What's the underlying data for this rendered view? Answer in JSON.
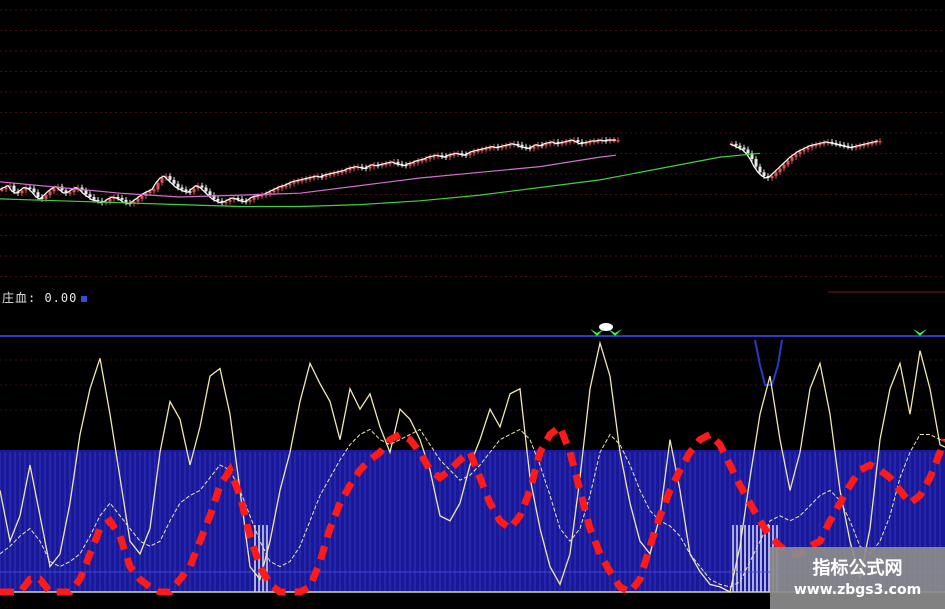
{
  "indicator": {
    "label": "庄血: 0.00"
  },
  "watermark": {
    "title": "指标公式网",
    "url": "www.zbgs3.com"
  },
  "colors": {
    "background": "#000000",
    "gridline": "#7a1c1c",
    "up_candle": "#e05050",
    "down_candle": "#e8e8e8",
    "ma_short": "#ffffff",
    "ma_mid": "#d070d0",
    "ma_long": "#40d040",
    "osc_line": "#f0e8b0",
    "blue_zone": "#1e1ebe",
    "red_line": "#ff1a1a",
    "signal": "#30ff30",
    "divider": "#2a3ac8"
  },
  "chart_data": [
    {
      "type": "candlestick",
      "panel": "price",
      "grid": true,
      "ylim": [
        0,
        100
      ],
      "x": [
        0,
        4,
        8,
        12,
        16,
        20,
        24,
        28,
        32,
        36,
        40,
        44,
        48,
        52,
        56,
        60,
        64,
        68,
        72,
        76,
        80,
        84,
        88,
        92,
        96,
        100,
        104,
        108,
        112,
        116,
        120,
        124,
        128,
        132,
        136,
        140,
        144,
        148,
        152,
        156,
        160,
        164,
        168,
        172,
        176,
        180,
        184,
        188,
        192,
        196,
        200,
        204,
        208,
        212,
        216,
        220,
        224,
        228,
        232,
        236,
        240,
        244,
        248,
        252,
        256,
        260,
        264,
        268,
        272,
        276,
        280,
        284,
        288,
        292,
        296,
        300,
        304,
        308,
        312,
        316,
        320,
        324,
        328,
        332,
        336,
        340,
        344,
        348,
        352,
        356,
        360,
        364,
        368,
        372,
        376,
        380,
        384,
        388,
        392,
        396,
        400,
        404,
        408,
        412,
        416,
        420,
        424,
        428,
        432,
        436,
        440,
        444,
        448,
        452,
        456,
        460,
        464,
        468,
        472,
        476,
        480,
        484,
        488,
        492,
        496,
        500,
        504,
        508,
        512,
        516,
        520,
        524,
        528,
        532,
        536,
        540,
        544,
        548,
        552,
        556,
        560,
        564,
        568,
        572,
        576,
        580,
        584,
        588,
        592,
        596,
        600,
        604,
        608,
        612,
        616
      ],
      "close": [
        48,
        50,
        52,
        46,
        44,
        47,
        50,
        49,
        45,
        40,
        38,
        42,
        46,
        49,
        51,
        47,
        44,
        45,
        48,
        50,
        47,
        43,
        40,
        37,
        36,
        34,
        35,
        38,
        40,
        39,
        37,
        34,
        33,
        35,
        38,
        41,
        44,
        46,
        48,
        55,
        60,
        62,
        58,
        54,
        50,
        48,
        46,
        45,
        49,
        52,
        50,
        46,
        42,
        38,
        36,
        34,
        35,
        37,
        39,
        38,
        36,
        35,
        37,
        40,
        41,
        42,
        43,
        45,
        47,
        49,
        51,
        52,
        54,
        56,
        57,
        58,
        59,
        60,
        61,
        62,
        61,
        63,
        64,
        65,
        66,
        67,
        68,
        70,
        71,
        72,
        71,
        70,
        72,
        74,
        73,
        74,
        75,
        76,
        77,
        75,
        74,
        73,
        75,
        76,
        78,
        79,
        80,
        82,
        83,
        84,
        83,
        82,
        84,
        85,
        86,
        85,
        84,
        86,
        88,
        89,
        90,
        91,
        92,
        93,
        92,
        93,
        94,
        95,
        96,
        95,
        93,
        92,
        91,
        93,
        95,
        94,
        96,
        97,
        98,
        96,
        97,
        98,
        99,
        100,
        98,
        96,
        97,
        98,
        99,
        99,
        100,
        99,
        100,
        100,
        100
      ],
      "ma_short_note": "follows close",
      "segment2": {
        "x": [
          730,
          734,
          738,
          742,
          746,
          750,
          754,
          758,
          762,
          766,
          770,
          774,
          778,
          782,
          786,
          790,
          794,
          798,
          802,
          806,
          810,
          814,
          818,
          822,
          826,
          830,
          834,
          838,
          842,
          846,
          850,
          854,
          858,
          862,
          866,
          870,
          874,
          878
        ],
        "close": [
          96,
          94,
          92,
          90,
          86,
          80,
          72,
          66,
          62,
          60,
          62,
          66,
          70,
          74,
          78,
          82,
          85,
          88,
          90,
          92,
          94,
          95,
          96,
          97,
          98,
          97,
          96,
          95,
          94,
          93,
          92,
          93,
          94,
          95,
          96,
          97,
          98,
          99
        ]
      },
      "series": [
        {
          "name": "",
          "role": "ma_mid",
          "x": [
            0,
            60,
            120,
            180,
            240,
            300,
            360,
            420,
            480,
            540,
            600,
            616
          ],
          "y": [
            56,
            50,
            44,
            40,
            42,
            44,
            52,
            60,
            66,
            72,
            82,
            84
          ]
        },
        {
          "name": "",
          "role": "ma_long",
          "x": [
            0,
            60,
            120,
            180,
            240,
            300,
            360,
            420,
            480,
            540,
            600,
            660,
            720,
            760
          ],
          "y": [
            38,
            36,
            34,
            32,
            30,
            30,
            32,
            36,
            42,
            50,
            58,
            70,
            82,
            86
          ]
        }
      ]
    },
    {
      "type": "line",
      "panel": "oscillator",
      "grid": false,
      "ylim": [
        0,
        100
      ],
      "x": [
        0,
        10,
        20,
        30,
        40,
        50,
        60,
        70,
        80,
        90,
        100,
        110,
        120,
        130,
        140,
        150,
        160,
        170,
        180,
        190,
        200,
        210,
        220,
        230,
        240,
        250,
        260,
        270,
        280,
        290,
        300,
        310,
        320,
        330,
        340,
        350,
        360,
        370,
        380,
        390,
        400,
        410,
        420,
        430,
        440,
        450,
        460,
        470,
        480,
        490,
        500,
        510,
        520,
        530,
        540,
        550,
        560,
        570,
        580,
        590,
        600,
        610,
        620,
        630,
        640,
        650,
        660,
        670,
        680,
        690,
        700,
        710,
        720,
        730,
        740,
        750,
        760,
        770,
        780,
        790,
        800,
        810,
        820,
        830,
        840,
        850,
        860,
        870,
        880,
        890,
        900,
        910,
        920,
        930,
        940,
        945
      ],
      "series": [
        {
          "name": "",
          "role": "osc_line",
          "y": [
            40,
            20,
            30,
            50,
            30,
            10,
            15,
            35,
            62,
            80,
            92,
            70,
            45,
            20,
            15,
            25,
            55,
            75,
            68,
            50,
            65,
            85,
            88,
            70,
            40,
            10,
            5,
            20,
            40,
            55,
            75,
            90,
            82,
            75,
            60,
            80,
            72,
            78,
            65,
            55,
            72,
            68,
            60,
            48,
            30,
            28,
            35,
            50,
            60,
            72,
            65,
            78,
            80,
            45,
            25,
            10,
            3,
            15,
            45,
            80,
            98,
            85,
            55,
            35,
            20,
            15,
            30,
            60,
            40,
            15,
            8,
            3,
            2,
            0,
            18,
            45,
            70,
            85,
            60,
            40,
            55,
            80,
            90,
            70,
            40,
            20,
            5,
            25,
            60,
            80,
            90,
            70,
            95,
            80,
            58,
            57
          ]
        },
        {
          "name": "",
          "role": "ma_line",
          "y": [
            15,
            18,
            22,
            25,
            20,
            12,
            10,
            12,
            15,
            22,
            30,
            35,
            30,
            25,
            20,
            18,
            20,
            28,
            35,
            38,
            40,
            45,
            50,
            48,
            40,
            30,
            20,
            12,
            10,
            12,
            18,
            28,
            38,
            45,
            52,
            58,
            62,
            64,
            60,
            58,
            60,
            62,
            64,
            58,
            52,
            48,
            44,
            46,
            50,
            55,
            60,
            62,
            64,
            60,
            50,
            38,
            25,
            20,
            25,
            38,
            55,
            62,
            58,
            50,
            40,
            32,
            28,
            26,
            22,
            15,
            10,
            5,
            3,
            2,
            4,
            12,
            20,
            28,
            30,
            28,
            30,
            34,
            38,
            40,
            36,
            28,
            18,
            15,
            20,
            30,
            45,
            55,
            62,
            62,
            60,
            60
          ]
        },
        {
          "name": "",
          "role": "red_line",
          "y": [
            0,
            0,
            0,
            5,
            5,
            0,
            0,
            0,
            5,
            15,
            25,
            28,
            22,
            10,
            5,
            2,
            0,
            0,
            5,
            10,
            20,
            30,
            42,
            48,
            38,
            22,
            10,
            3,
            0,
            0,
            0,
            2,
            12,
            25,
            35,
            42,
            48,
            52,
            55,
            60,
            62,
            60,
            55,
            48,
            45,
            48,
            52,
            55,
            45,
            35,
            28,
            25,
            30,
            40,
            55,
            62,
            65,
            55,
            40,
            25,
            15,
            8,
            2,
            0,
            5,
            18,
            30,
            40,
            48,
            55,
            60,
            62,
            58,
            50,
            42,
            35,
            28,
            22,
            18,
            15,
            15,
            18,
            20,
            28,
            35,
            42,
            48,
            50,
            48,
            45,
            40,
            35,
            38,
            45,
            55,
            60
          ]
        }
      ]
    }
  ]
}
